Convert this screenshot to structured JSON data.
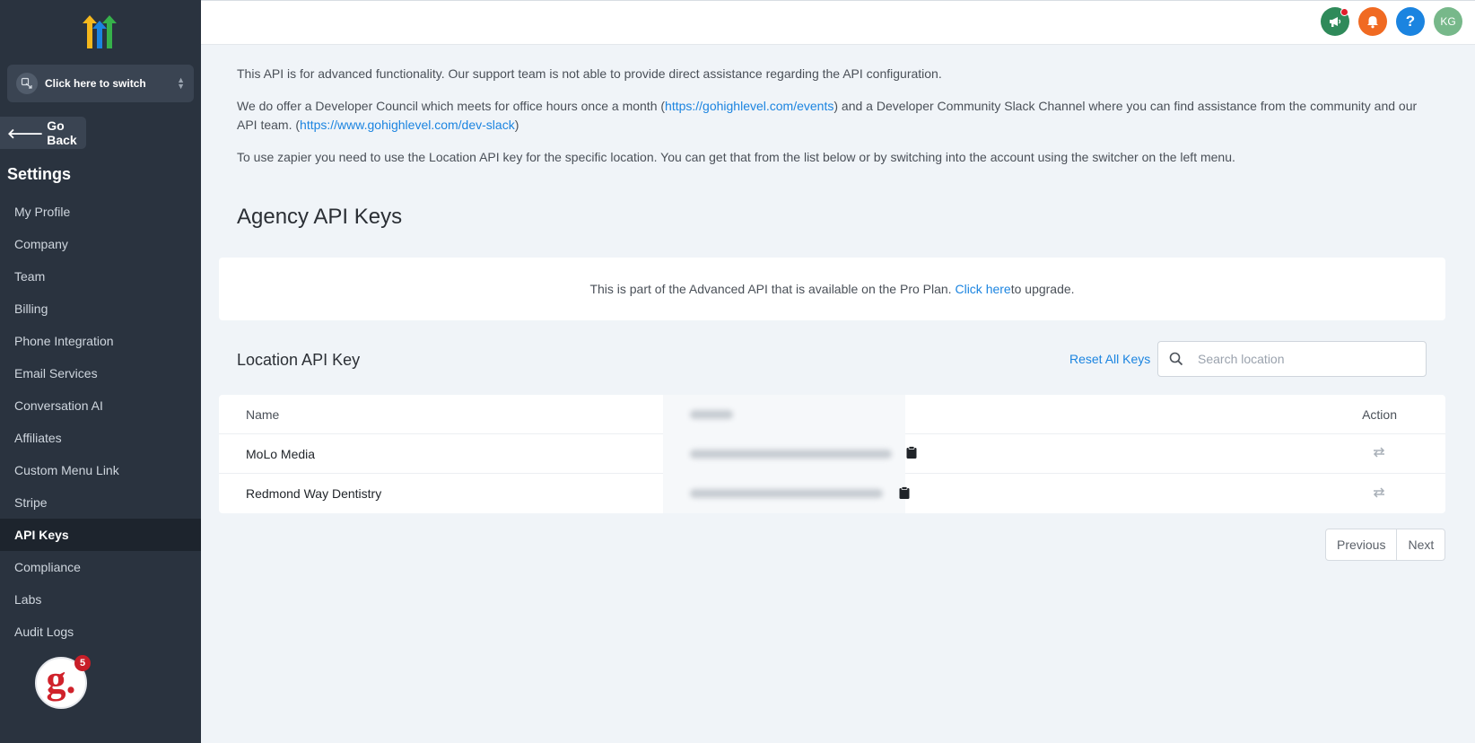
{
  "sidebar": {
    "switcher_label": "Click here to switch",
    "go_back": "Go Back",
    "settings_title": "Settings",
    "items": [
      {
        "label": "My Profile"
      },
      {
        "label": "Company"
      },
      {
        "label": "Team"
      },
      {
        "label": "Billing"
      },
      {
        "label": "Phone Integration"
      },
      {
        "label": "Email Services"
      },
      {
        "label": "Conversation AI"
      },
      {
        "label": "Affiliates"
      },
      {
        "label": "Custom Menu Link"
      },
      {
        "label": "Stripe"
      },
      {
        "label": "API Keys",
        "active": true
      },
      {
        "label": "Compliance"
      },
      {
        "label": "Labs"
      },
      {
        "label": "Audit Logs"
      }
    ],
    "badge": {
      "letter": "g.",
      "count": "5"
    }
  },
  "topbar": {
    "avatar_initials": "KG",
    "help_glyph": "?",
    "icons": [
      "megaphone-icon",
      "bell-icon",
      "help-icon",
      "avatar"
    ],
    "colors": {
      "announce": "#2f8a5a",
      "bell": "#f06a22",
      "help": "#1b84e0",
      "avatar": "#77b88a"
    }
  },
  "intro": {
    "p1": "This API is for advanced functionality. Our support team is not able to provide direct assistance regarding the API configuration.",
    "p2_a": "We do offer a Developer Council which meets for office hours once a month (",
    "p2_link1": "https://gohighlevel.com/events",
    "p2_b": ") and a Developer Community Slack Channel where you can find assistance from the community and our API team. (",
    "p2_link2": "https://www.gohighlevel.com/dev-slack",
    "p2_c": ")",
    "p3": "To use zapier you need to use the Location API key for the specific location. You can get that from the list below or by switching into the account using the switcher on the left menu."
  },
  "agency": {
    "title": "Agency API Keys",
    "pro_text_a": "This is part of the Advanced API that is available on the Pro Plan. ",
    "pro_link": "Click here",
    "pro_text_b": " to upgrade."
  },
  "location": {
    "title": "Location API Key",
    "reset_all": "Reset All Keys",
    "search_placeholder": "Search location",
    "columns": {
      "name": "Name",
      "action": "Action"
    },
    "rows": [
      {
        "name": "MoLo Media"
      },
      {
        "name": "Redmond Way Dentistry"
      }
    ]
  },
  "pagination": {
    "previous": "Previous",
    "next": "Next"
  },
  "colors": {
    "sidebar": "#2a333f",
    "accent": "#1b84e0",
    "background": "#f0f4f8"
  }
}
